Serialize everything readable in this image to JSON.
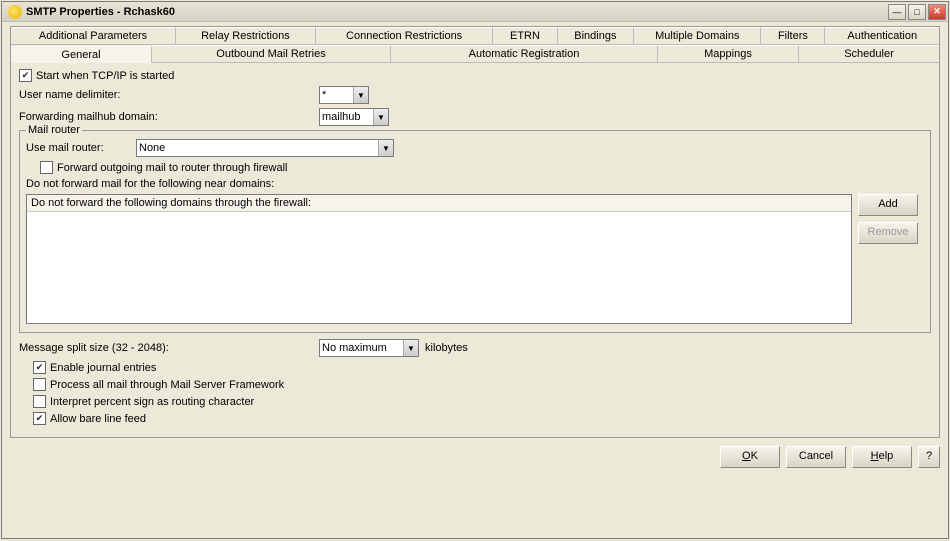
{
  "window": {
    "title": "SMTP Properties - Rchask60"
  },
  "tabs": {
    "row1": [
      "Additional Parameters",
      "Relay Restrictions",
      "Connection Restrictions",
      "ETRN",
      "Bindings",
      "Multiple Domains",
      "Filters",
      "Authentication"
    ],
    "row2": [
      "General",
      "Outbound Mail Retries",
      "Automatic Registration",
      "Mappings",
      "Scheduler"
    ],
    "active": "General"
  },
  "general": {
    "start_when_tcpip": {
      "label": "Start when TCP/IP is started",
      "checked": true
    },
    "user_name_delimiter": {
      "label": "User name delimiter:",
      "value": "*"
    },
    "forwarding_mailhub_domain": {
      "label": "Forwarding mailhub domain:",
      "value": "mailhub"
    },
    "mail_router": {
      "legend": "Mail router",
      "use_mail_router": {
        "label": "Use mail router:",
        "value": "None"
      },
      "forward_outgoing": {
        "label": "Forward outgoing mail to router through firewall",
        "checked": false
      },
      "near_domains_label": "Do not forward mail for the following near domains:",
      "list_header": "Do not forward the following domains through the firewall:",
      "add_label": "Add",
      "remove_label": "Remove"
    },
    "message_split": {
      "label": "Message split size (32 - 2048):",
      "value": "No maximum",
      "unit": "kilobytes"
    },
    "enable_journal": {
      "label": "Enable journal entries",
      "checked": true
    },
    "process_msf": {
      "label": "Process all mail through Mail Server Framework",
      "checked": false
    },
    "interpret_percent": {
      "label": "Interpret percent sign as routing character",
      "checked": false
    },
    "allow_bare_lf": {
      "label": "Allow bare line feed",
      "checked": true
    }
  },
  "buttons": {
    "ok": "OK",
    "cancel": "Cancel",
    "help": "Help",
    "helpq": "?"
  }
}
